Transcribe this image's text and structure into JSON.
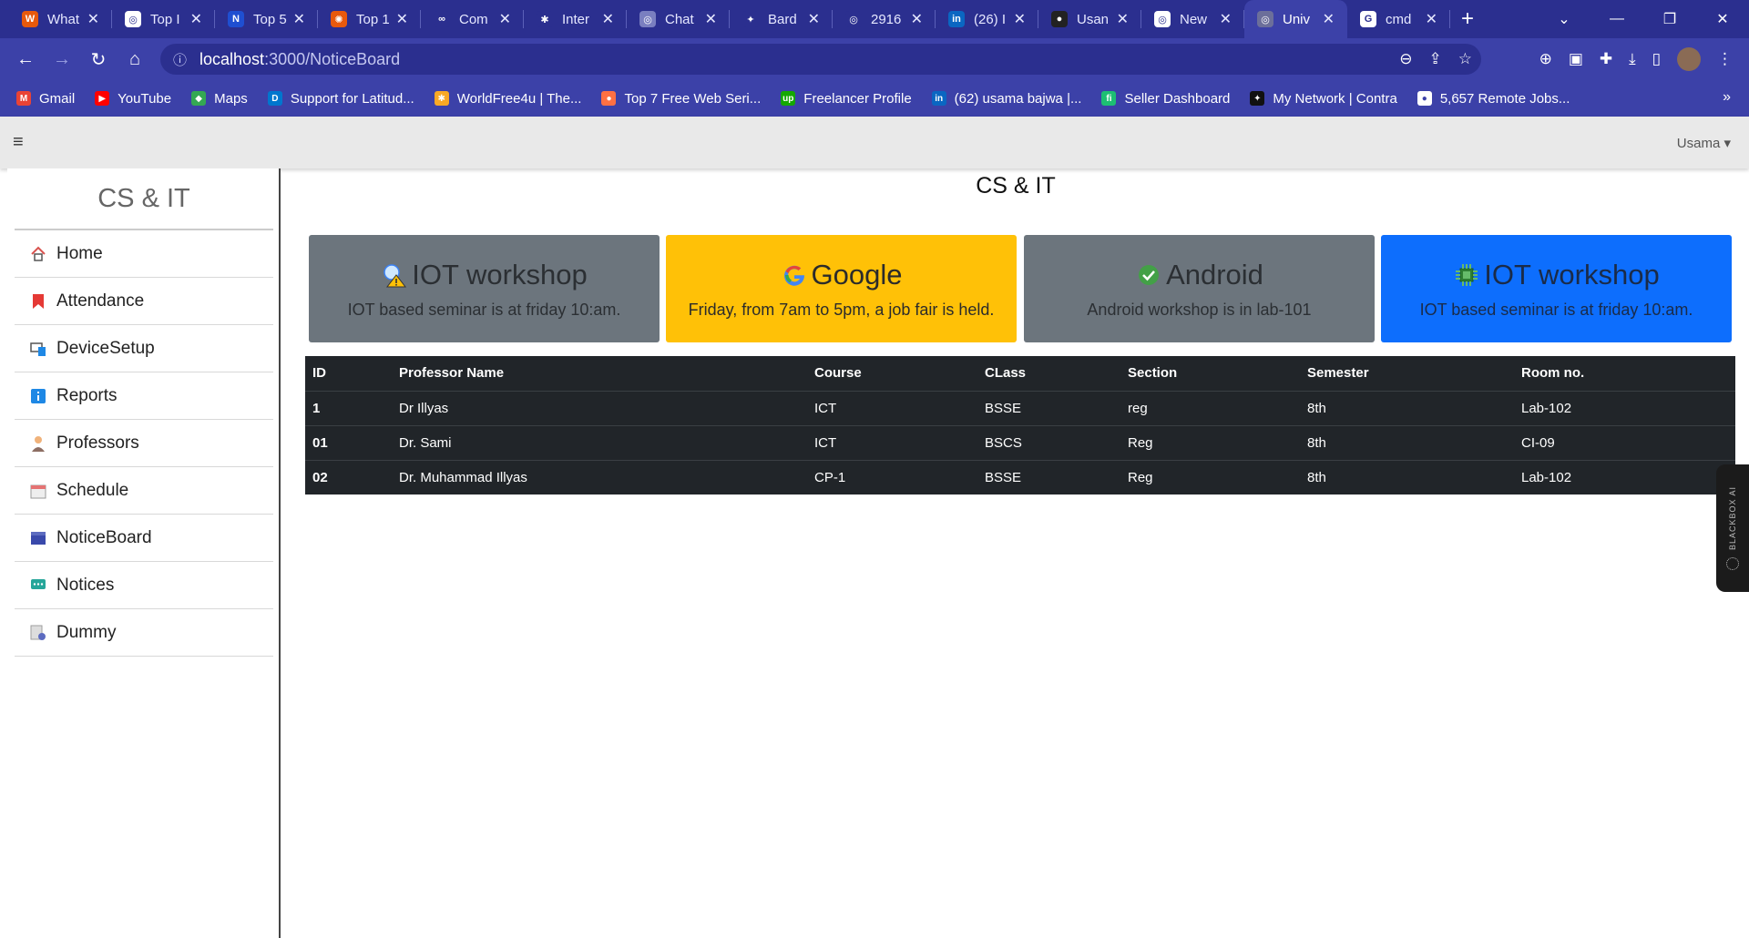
{
  "browser": {
    "tabs": [
      {
        "title": "What",
        "fav_color": "#e8590c",
        "fav_glyph": "W"
      },
      {
        "title": "Top I",
        "fav_color": "#ffffff",
        "fav_glyph": "◎"
      },
      {
        "title": "Top 5",
        "fav_color": "#1f4fd1",
        "fav_glyph": "N"
      },
      {
        "title": "Top 1",
        "fav_color": "#e8590c",
        "fav_glyph": "✺"
      },
      {
        "title": "Com",
        "fav_color": "#2b2f8f",
        "fav_glyph": "∞"
      },
      {
        "title": "Inter",
        "fav_color": "#2b2f8f",
        "fav_glyph": "✱"
      },
      {
        "title": "Chat",
        "fav_color": "#7a7fc0",
        "fav_glyph": "◎"
      },
      {
        "title": "Bard",
        "fav_color": "#2b2f8f",
        "fav_glyph": "✦"
      },
      {
        "title": "2916",
        "fav_color": "#2b2f8f",
        "fav_glyph": "◎"
      },
      {
        "title": "(26) I",
        "fav_color": "#0a66c2",
        "fav_glyph": "in"
      },
      {
        "title": "Usan",
        "fav_color": "#222222",
        "fav_glyph": "●"
      },
      {
        "title": "New",
        "fav_color": "#ffffff",
        "fav_glyph": "◎"
      },
      {
        "title": "Univ",
        "fav_color": "#6c6f9a",
        "fav_glyph": "◎"
      },
      {
        "title": "cmd",
        "fav_color": "#ffffff",
        "fav_glyph": "G"
      }
    ],
    "url_host": "localhost",
    "url_path": ":3000/NoticeBoard",
    "bookmarks": [
      {
        "label": "Gmail",
        "color": "#ea4335",
        "glyph": "M"
      },
      {
        "label": "YouTube",
        "color": "#ff0000",
        "glyph": "▶"
      },
      {
        "label": "Maps",
        "color": "#34a853",
        "glyph": "◆"
      },
      {
        "label": "Support for Latitud...",
        "color": "#0076ce",
        "glyph": "D"
      },
      {
        "label": "WorldFree4u | The...",
        "color": "#f9a825",
        "glyph": "✱"
      },
      {
        "label": "Top 7 Free Web Seri...",
        "color": "#ff7043",
        "glyph": "●"
      },
      {
        "label": "Freelancer Profile",
        "color": "#14a800",
        "glyph": "up"
      },
      {
        "label": "(62) usama bajwa |...",
        "color": "#0a66c2",
        "glyph": "in"
      },
      {
        "label": "Seller Dashboard",
        "color": "#1dbf73",
        "glyph": "fi"
      },
      {
        "label": "My Network | Contra",
        "color": "#111111",
        "glyph": "✦"
      },
      {
        "label": "5,657 Remote Jobs...",
        "color": "#ffffff",
        "glyph": "●"
      }
    ]
  },
  "app": {
    "user_menu": "Usama ▾",
    "brand": "CS & IT",
    "page_title": "CS & IT",
    "menu": [
      {
        "label": "Home",
        "icon": "home-icon",
        "color": "#d9534f"
      },
      {
        "label": "Attendance",
        "icon": "bookmark-icon",
        "color": "#e53935"
      },
      {
        "label": "DeviceSetup",
        "icon": "device-icon",
        "color": "#1e88e5"
      },
      {
        "label": "Reports",
        "icon": "info-icon",
        "color": "#1e88e5"
      },
      {
        "label": "Professors",
        "icon": "person-icon",
        "color": "#8d6e63"
      },
      {
        "label": "Schedule",
        "icon": "calendar-icon",
        "color": "#e57373"
      },
      {
        "label": "NoticeBoard",
        "icon": "clapper-icon",
        "color": "#3949ab"
      },
      {
        "label": "Notices",
        "icon": "chat-icon",
        "color": "#26a69a"
      },
      {
        "label": "Dummy",
        "icon": "settings-doc-icon",
        "color": "#9e9e9e"
      }
    ],
    "cards": [
      {
        "title": "IOT workshop",
        "body": "IOT based seminar is at friday 10:am.",
        "icon": "warning-bulb-icon",
        "variant": "gray"
      },
      {
        "title": "Google",
        "body": "Friday, from 7am to 5pm, a job fair is held.",
        "icon": "google-icon",
        "variant": "yellow"
      },
      {
        "title": "Android",
        "body": "Android workshop is in lab-101",
        "icon": "check-icon",
        "variant": "gray"
      },
      {
        "title": "IOT workshop",
        "body": "IOT based seminar is at friday 10:am.",
        "icon": "chip-icon",
        "variant": "blue"
      }
    ],
    "table": {
      "headers": [
        "ID",
        "Professor Name",
        "Course",
        "CLass",
        "Section",
        "Semester",
        "Room no."
      ],
      "rows": [
        [
          "1",
          "Dr Illyas",
          "ICT",
          "BSSE",
          "reg",
          "8th",
          "Lab-102"
        ],
        [
          "01",
          "Dr. Sami",
          "ICT",
          "BSCS",
          "Reg",
          "8th",
          "CI-09"
        ],
        [
          "02",
          "Dr. Muhammad Illyas",
          "CP-1",
          "BSSE",
          "Reg",
          "8th",
          "Lab-102"
        ]
      ]
    },
    "blackbox_label": "BLACKBOX AI"
  }
}
